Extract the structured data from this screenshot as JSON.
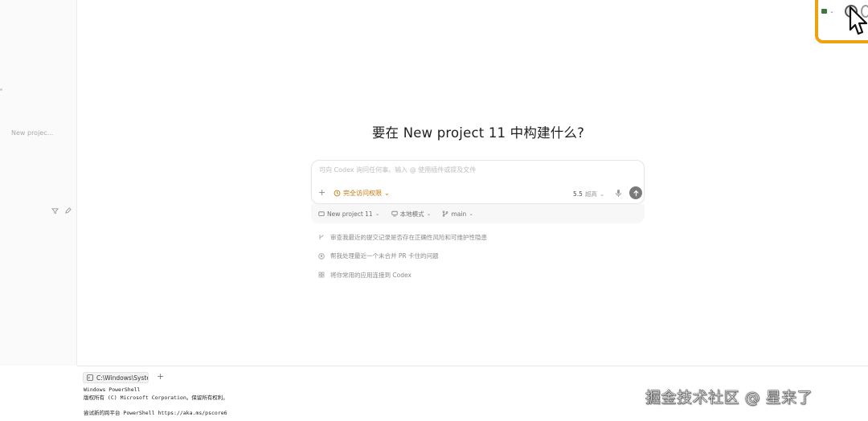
{
  "sidebar": {
    "project_label": "New projec..."
  },
  "heading": "要在 New project 11 中构建什么?",
  "composer": {
    "placeholder": "可向 Codex 询问任何事。输入 @ 使用插件或提及文件",
    "access_label": "完全访问权限",
    "model_version": "5.5",
    "model_level": "超高"
  },
  "meta": {
    "project": "New project 11",
    "mode": "本地模式",
    "branch": "main"
  },
  "suggestions": [
    {
      "icon": "git-commit-icon",
      "text": "审查我最近的提交记录是否存在正确性风险和可维护性隐患"
    },
    {
      "icon": "github-icon",
      "text": "帮我处理最近一个未合并 PR 卡住的问题"
    },
    {
      "icon": "apps-icon",
      "text": "将你常用的应用连接到 Codex"
    }
  ],
  "terminal": {
    "tab_label": "C:\\Windows\\Syste",
    "lines": [
      "Windows PowerShell",
      "版权所有 (C) Microsoft Corporation。保留所有权利。",
      "",
      "尝试新的跨平台 PowerShell https://aka.ms/pscore6"
    ]
  },
  "watermark": "掘金技术社区 @ 星来了"
}
